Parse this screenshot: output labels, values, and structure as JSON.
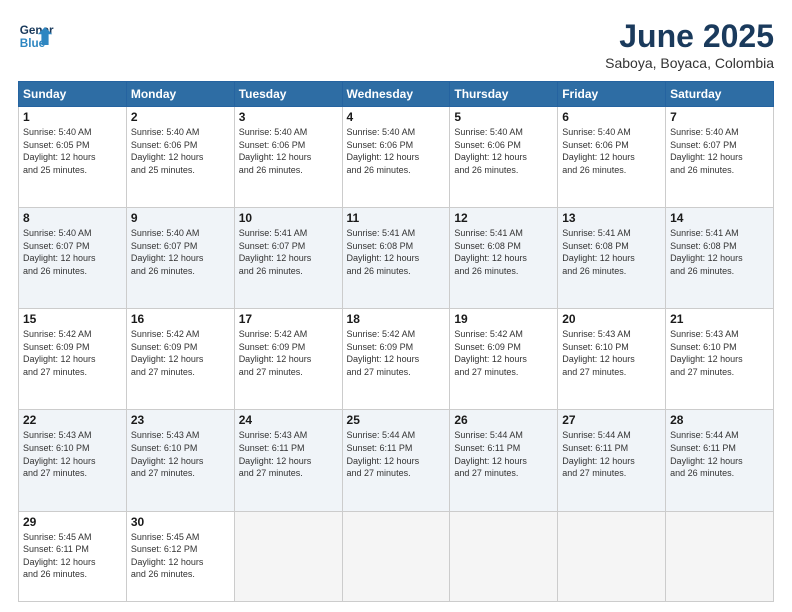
{
  "header": {
    "logo_line1": "General",
    "logo_line2": "Blue",
    "month": "June 2025",
    "location": "Saboya, Boyaca, Colombia"
  },
  "weekdays": [
    "Sunday",
    "Monday",
    "Tuesday",
    "Wednesday",
    "Thursday",
    "Friday",
    "Saturday"
  ],
  "weeks": [
    [
      {
        "day": "1",
        "info": "Sunrise: 5:40 AM\nSunset: 6:05 PM\nDaylight: 12 hours\nand 25 minutes."
      },
      {
        "day": "2",
        "info": "Sunrise: 5:40 AM\nSunset: 6:06 PM\nDaylight: 12 hours\nand 25 minutes."
      },
      {
        "day": "3",
        "info": "Sunrise: 5:40 AM\nSunset: 6:06 PM\nDaylight: 12 hours\nand 26 minutes."
      },
      {
        "day": "4",
        "info": "Sunrise: 5:40 AM\nSunset: 6:06 PM\nDaylight: 12 hours\nand 26 minutes."
      },
      {
        "day": "5",
        "info": "Sunrise: 5:40 AM\nSunset: 6:06 PM\nDaylight: 12 hours\nand 26 minutes."
      },
      {
        "day": "6",
        "info": "Sunrise: 5:40 AM\nSunset: 6:06 PM\nDaylight: 12 hours\nand 26 minutes."
      },
      {
        "day": "7",
        "info": "Sunrise: 5:40 AM\nSunset: 6:07 PM\nDaylight: 12 hours\nand 26 minutes."
      }
    ],
    [
      {
        "day": "8",
        "info": "Sunrise: 5:40 AM\nSunset: 6:07 PM\nDaylight: 12 hours\nand 26 minutes."
      },
      {
        "day": "9",
        "info": "Sunrise: 5:40 AM\nSunset: 6:07 PM\nDaylight: 12 hours\nand 26 minutes."
      },
      {
        "day": "10",
        "info": "Sunrise: 5:41 AM\nSunset: 6:07 PM\nDaylight: 12 hours\nand 26 minutes."
      },
      {
        "day": "11",
        "info": "Sunrise: 5:41 AM\nSunset: 6:08 PM\nDaylight: 12 hours\nand 26 minutes."
      },
      {
        "day": "12",
        "info": "Sunrise: 5:41 AM\nSunset: 6:08 PM\nDaylight: 12 hours\nand 26 minutes."
      },
      {
        "day": "13",
        "info": "Sunrise: 5:41 AM\nSunset: 6:08 PM\nDaylight: 12 hours\nand 26 minutes."
      },
      {
        "day": "14",
        "info": "Sunrise: 5:41 AM\nSunset: 6:08 PM\nDaylight: 12 hours\nand 26 minutes."
      }
    ],
    [
      {
        "day": "15",
        "info": "Sunrise: 5:42 AM\nSunset: 6:09 PM\nDaylight: 12 hours\nand 27 minutes."
      },
      {
        "day": "16",
        "info": "Sunrise: 5:42 AM\nSunset: 6:09 PM\nDaylight: 12 hours\nand 27 minutes."
      },
      {
        "day": "17",
        "info": "Sunrise: 5:42 AM\nSunset: 6:09 PM\nDaylight: 12 hours\nand 27 minutes."
      },
      {
        "day": "18",
        "info": "Sunrise: 5:42 AM\nSunset: 6:09 PM\nDaylight: 12 hours\nand 27 minutes."
      },
      {
        "day": "19",
        "info": "Sunrise: 5:42 AM\nSunset: 6:09 PM\nDaylight: 12 hours\nand 27 minutes."
      },
      {
        "day": "20",
        "info": "Sunrise: 5:43 AM\nSunset: 6:10 PM\nDaylight: 12 hours\nand 27 minutes."
      },
      {
        "day": "21",
        "info": "Sunrise: 5:43 AM\nSunset: 6:10 PM\nDaylight: 12 hours\nand 27 minutes."
      }
    ],
    [
      {
        "day": "22",
        "info": "Sunrise: 5:43 AM\nSunset: 6:10 PM\nDaylight: 12 hours\nand 27 minutes."
      },
      {
        "day": "23",
        "info": "Sunrise: 5:43 AM\nSunset: 6:10 PM\nDaylight: 12 hours\nand 27 minutes."
      },
      {
        "day": "24",
        "info": "Sunrise: 5:43 AM\nSunset: 6:11 PM\nDaylight: 12 hours\nand 27 minutes."
      },
      {
        "day": "25",
        "info": "Sunrise: 5:44 AM\nSunset: 6:11 PM\nDaylight: 12 hours\nand 27 minutes."
      },
      {
        "day": "26",
        "info": "Sunrise: 5:44 AM\nSunset: 6:11 PM\nDaylight: 12 hours\nand 27 minutes."
      },
      {
        "day": "27",
        "info": "Sunrise: 5:44 AM\nSunset: 6:11 PM\nDaylight: 12 hours\nand 27 minutes."
      },
      {
        "day": "28",
        "info": "Sunrise: 5:44 AM\nSunset: 6:11 PM\nDaylight: 12 hours\nand 26 minutes."
      }
    ],
    [
      {
        "day": "29",
        "info": "Sunrise: 5:45 AM\nSunset: 6:11 PM\nDaylight: 12 hours\nand 26 minutes."
      },
      {
        "day": "30",
        "info": "Sunrise: 5:45 AM\nSunset: 6:12 PM\nDaylight: 12 hours\nand 26 minutes."
      },
      {
        "day": "",
        "info": ""
      },
      {
        "day": "",
        "info": ""
      },
      {
        "day": "",
        "info": ""
      },
      {
        "day": "",
        "info": ""
      },
      {
        "day": "",
        "info": ""
      }
    ]
  ]
}
